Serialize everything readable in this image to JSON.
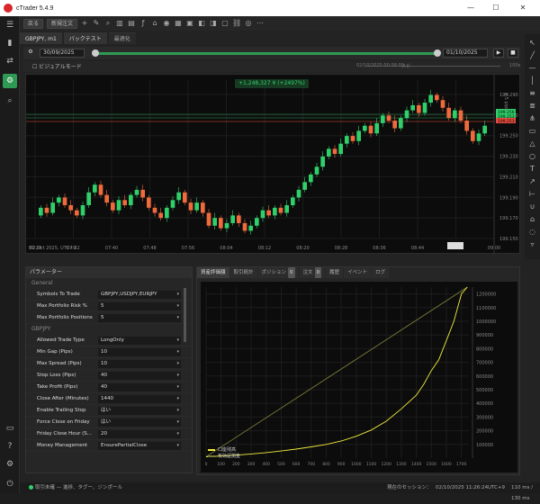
{
  "app": {
    "title": "cTrader 5.4.9"
  },
  "window_controls": {
    "minimize": "—",
    "maximize": "☐",
    "close": "✕"
  },
  "toolbar": {
    "back_label": "戻る",
    "new_order_label": "新規注文"
  },
  "chart_tabs": [
    {
      "label": "GBPJPY, m1"
    },
    {
      "label": "バックテスト"
    },
    {
      "label": "最適化"
    }
  ],
  "backtest": {
    "start_date": "30/09/2025",
    "end_date": "01/10/2025",
    "progress_fraction": 1.0
  },
  "visual_mode": {
    "label": "ビジュアルモード",
    "timestamp": "02/10/2025 00:58:00",
    "speed_label": "スピ",
    "speed_value": "100x"
  },
  "chart": {
    "profit_badge": "+1,248,327 ¥ (+2497%)",
    "axis_label": "2.5 pips",
    "date_label": "02 Oct 2025, UTC+9",
    "x_ticks": [
      "07:24",
      "07:32",
      "07:40",
      "07:48",
      "07:56",
      "08:04",
      "08:12",
      "08:20",
      "08:28",
      "08:36",
      "08:44",
      "08:52",
      "09:00"
    ],
    "y_ticks": [
      "199.290",
      "199.270",
      "199.250",
      "199.230",
      "199.210",
      "199.190",
      "199.170",
      "199.150"
    ],
    "price_tags": [
      {
        "label": "199.256",
        "color": "#2fd06a"
      },
      {
        "label": "199.253",
        "color": "#2fd06a"
      },
      {
        "label": "199.253",
        "color": "#e44b3c"
      }
    ],
    "colors": {
      "bull": "#2fd06a",
      "bear": "#ef6a3c"
    }
  },
  "chart_data": [
    {
      "type": "candlestick",
      "candles": [
        {
          "o": 4,
          "c": 10
        },
        {
          "o": 10,
          "c": 6
        },
        {
          "o": 6,
          "c": 14
        },
        {
          "o": 14,
          "c": 18
        },
        {
          "o": 18,
          "c": 12
        },
        {
          "o": 12,
          "c": 8
        },
        {
          "o": 8,
          "c": 4
        },
        {
          "o": 4,
          "c": 12
        },
        {
          "o": 12,
          "c": 22
        },
        {
          "o": 22,
          "c": 28
        },
        {
          "o": 28,
          "c": 20
        },
        {
          "o": 20,
          "c": 14
        },
        {
          "o": 14,
          "c": 8
        },
        {
          "o": 8,
          "c": 16
        },
        {
          "o": 16,
          "c": 12
        },
        {
          "o": 12,
          "c": 20
        },
        {
          "o": 20,
          "c": 24
        },
        {
          "o": 24,
          "c": 18
        },
        {
          "o": 18,
          "c": 10
        },
        {
          "o": 10,
          "c": 6
        },
        {
          "o": 6,
          "c": 2
        },
        {
          "o": 2,
          "c": 10
        },
        {
          "o": 10,
          "c": 16
        },
        {
          "o": 16,
          "c": 22
        },
        {
          "o": 22,
          "c": 14
        },
        {
          "o": 14,
          "c": 8
        },
        {
          "o": 8,
          "c": 14
        },
        {
          "o": 14,
          "c": 6
        },
        {
          "o": 6,
          "c": -4
        },
        {
          "o": -4,
          "c": 2
        },
        {
          "o": 2,
          "c": -6
        },
        {
          "o": -6,
          "c": -2
        },
        {
          "o": -2,
          "c": 4
        },
        {
          "o": 4,
          "c": -2
        },
        {
          "o": -2,
          "c": -8
        },
        {
          "o": -8,
          "c": -4
        },
        {
          "o": -4,
          "c": 2
        },
        {
          "o": 2,
          "c": 8
        },
        {
          "o": 8,
          "c": 4
        },
        {
          "o": 4,
          "c": 10
        },
        {
          "o": 10,
          "c": 6
        },
        {
          "o": 6,
          "c": 12
        },
        {
          "o": 12,
          "c": 18
        },
        {
          "o": 18,
          "c": 24
        },
        {
          "o": 24,
          "c": 30
        },
        {
          "o": 30,
          "c": 36
        },
        {
          "o": 36,
          "c": 42
        },
        {
          "o": 42,
          "c": 50
        },
        {
          "o": 50,
          "c": 56
        },
        {
          "o": 56,
          "c": 52
        },
        {
          "o": 52,
          "c": 60
        },
        {
          "o": 60,
          "c": 66
        },
        {
          "o": 66,
          "c": 62
        },
        {
          "o": 62,
          "c": 70
        },
        {
          "o": 70,
          "c": 74
        },
        {
          "o": 74,
          "c": 68
        },
        {
          "o": 68,
          "c": 76
        },
        {
          "o": 76,
          "c": 82
        },
        {
          "o": 82,
          "c": 78
        },
        {
          "o": 78,
          "c": 72
        },
        {
          "o": 72,
          "c": 80
        },
        {
          "o": 80,
          "c": 86
        },
        {
          "o": 86,
          "c": 90
        },
        {
          "o": 90,
          "c": 84
        },
        {
          "o": 84,
          "c": 92
        },
        {
          "o": 92,
          "c": 98
        },
        {
          "o": 98,
          "c": 94
        },
        {
          "o": 94,
          "c": 88
        },
        {
          "o": 88,
          "c": 80
        },
        {
          "o": 80,
          "c": 86
        },
        {
          "o": 86,
          "c": 78
        },
        {
          "o": 78,
          "c": 70
        },
        {
          "o": 70,
          "c": 62
        },
        {
          "o": 62,
          "c": 68
        },
        {
          "o": 68,
          "c": 74
        }
      ]
    },
    {
      "type": "line",
      "x_ticks": [
        "0",
        "100",
        "200",
        "300",
        "400",
        "500",
        "600",
        "700",
        "800",
        "900",
        "1000",
        "1100",
        "1200",
        "1300",
        "1400",
        "1500",
        "1600",
        "1700"
      ],
      "y_ticks": [
        "1200000",
        "1100000",
        "1000000",
        "900000",
        "800000",
        "700000",
        "600000",
        "500000",
        "400000",
        "300000",
        "200000",
        "100000"
      ],
      "ylim": [
        0,
        1250000
      ],
      "xlim": [
        0,
        1750
      ],
      "series": [
        {
          "name": "口座残高",
          "color": "#f2ea3c",
          "points": [
            [
              0,
              10000
            ],
            [
              100,
              15000
            ],
            [
              200,
              22000
            ],
            [
              300,
              30000
            ],
            [
              400,
              40000
            ],
            [
              500,
              52000
            ],
            [
              600,
              66000
            ],
            [
              700,
              82000
            ],
            [
              800,
              100000
            ],
            [
              900,
              125000
            ],
            [
              1000,
              160000
            ],
            [
              1100,
              205000
            ],
            [
              1200,
              270000
            ],
            [
              1300,
              360000
            ],
            [
              1400,
              460000
            ],
            [
              1450,
              540000
            ],
            [
              1500,
              640000
            ],
            [
              1550,
              720000
            ],
            [
              1600,
              860000
            ],
            [
              1650,
              1000000
            ],
            [
              1700,
              1200000
            ],
            [
              1740,
              1250000
            ]
          ]
        },
        {
          "name": "有効証拠金",
          "color": "#7a7a3a",
          "points": [
            [
              0,
              10000
            ],
            [
              1740,
              1250000
            ]
          ]
        }
      ]
    }
  ],
  "parameters": {
    "header": "パラメーター",
    "general_label": "General",
    "symbol_label": "GBPJPY",
    "rows_general": [
      {
        "label": "Symbols To Trade",
        "value": "GBPJPY,USDJPY,EURJPY"
      },
      {
        "label": "Max Portfolio Risk %",
        "value": "5"
      },
      {
        "label": "Max Portfolio Positions",
        "value": "5"
      }
    ],
    "rows_symbol": [
      {
        "label": "Allowed Trade Type",
        "value": "LongOnly"
      },
      {
        "label": "Min Gap (Pips)",
        "value": "10"
      },
      {
        "label": "Max Spread (Pips)",
        "value": "10"
      },
      {
        "label": "Stop Loss (Pips)",
        "value": "40"
      },
      {
        "label": "Take Profit (Pips)",
        "value": "40"
      },
      {
        "label": "Close After (Minutes)",
        "value": "1440"
      },
      {
        "label": "Enable Trailing Stop",
        "value": "はい"
      },
      {
        "label": "Force Close on Friday",
        "value": "はい"
      },
      {
        "label": "Friday Close Hour (S...",
        "value": "20"
      },
      {
        "label": "Money Management",
        "value": "EnsurePartialClose"
      }
    ]
  },
  "results_tabs": [
    {
      "label": "資産評価額"
    },
    {
      "label": "取引統計"
    },
    {
      "label": "ポジション",
      "count": "0"
    },
    {
      "label": "注文",
      "count": "0"
    },
    {
      "label": "履歴"
    },
    {
      "label": "イベント"
    },
    {
      "label": "ログ"
    }
  ],
  "status": {
    "left": "取引未確 — 進捗、タグー、ジンポール",
    "right": "現在のセッション：",
    "time": "02/10/2025 11:26:24",
    "zone": "UTC+9",
    "ping": "110 ms / 130 ms"
  }
}
